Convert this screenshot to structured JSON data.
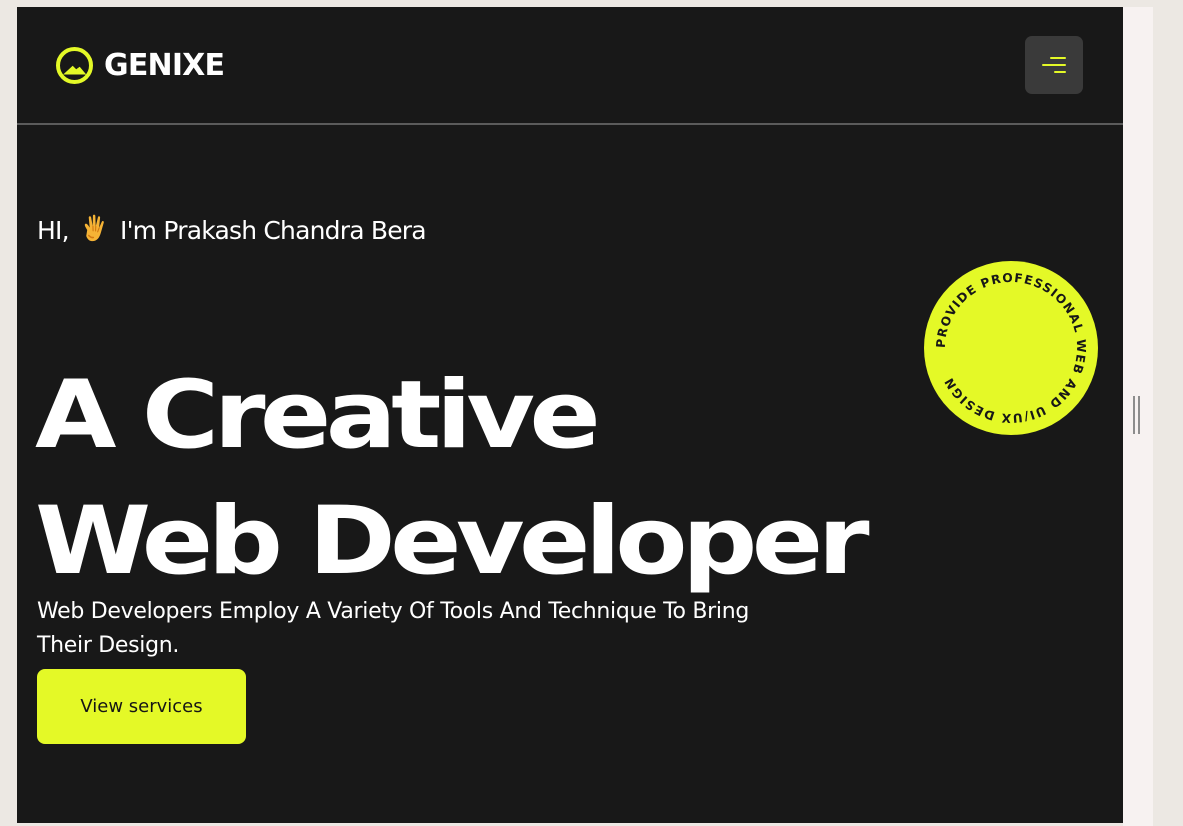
{
  "brand": {
    "name": "GENIXE",
    "logo_icon": "circle-mountain-logo-icon",
    "accent_color": "#e4f927",
    "background_color": "#181818"
  },
  "header": {
    "menu_icon": "hamburger-menu-icon"
  },
  "hero": {
    "greeting_prefix": "HI,",
    "greeting_icon": "waving-hand-icon",
    "greeting_name": "I'm Prakash Chandra Bera",
    "headline_line_1": "A Creative",
    "headline_line_2": "Web Developer",
    "subtitle": "Web Developers Employ A Variety Of Tools And Technique To Bring Their Design.",
    "cta_label": "View services",
    "badge_text": "PROVIDE PROFESSIONAL WEB AND UI/UX DESIGN"
  },
  "window": {
    "resize_icon": "vertical-resize-handle-icon"
  }
}
